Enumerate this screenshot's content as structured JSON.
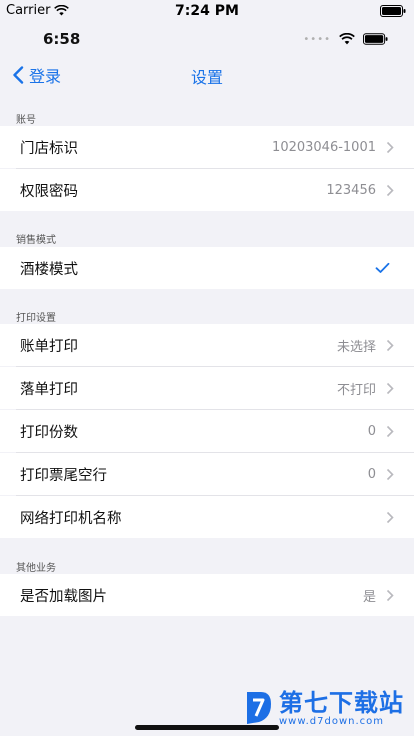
{
  "sim_status": {
    "carrier": "Carrier",
    "time": "7:24 PM"
  },
  "app_status": {
    "time": "6:58",
    "signal_dots": "••••"
  },
  "nav": {
    "back_label": "登录",
    "title": "设置"
  },
  "sections": {
    "account": {
      "header": "账号",
      "store_id": {
        "label": "门店标识",
        "value": "10203046-1001"
      },
      "permission_pwd": {
        "label": "权限密码",
        "value": "123456"
      }
    },
    "sales_mode": {
      "header": "销售模式",
      "bar_mode": {
        "label": "酒楼模式",
        "checked": true
      }
    },
    "print": {
      "header": "打印设置",
      "bill_print": {
        "label": "账单打印",
        "value": "未选择"
      },
      "order_print": {
        "label": "落单打印",
        "value": "不打印"
      },
      "copies": {
        "label": "打印份数",
        "value": "0"
      },
      "footer_blank": {
        "label": "打印票尾空行",
        "value": "0"
      },
      "network_printer": {
        "label": "网络打印机名称",
        "value": ""
      }
    },
    "other": {
      "header": "其他业务",
      "load_images": {
        "label": "是否加载图片",
        "value": "是"
      }
    }
  },
  "watermark": {
    "title": "第七下载站",
    "sub": "www.d7down.com"
  },
  "colors": {
    "accent": "#1a73e8",
    "value_gray": "#8e8e93",
    "background": "#f2f2f7"
  },
  "icons": [
    "wifi-icon",
    "battery-icon",
    "chevron-left-icon",
    "chevron-right-icon",
    "checkmark-icon"
  ]
}
